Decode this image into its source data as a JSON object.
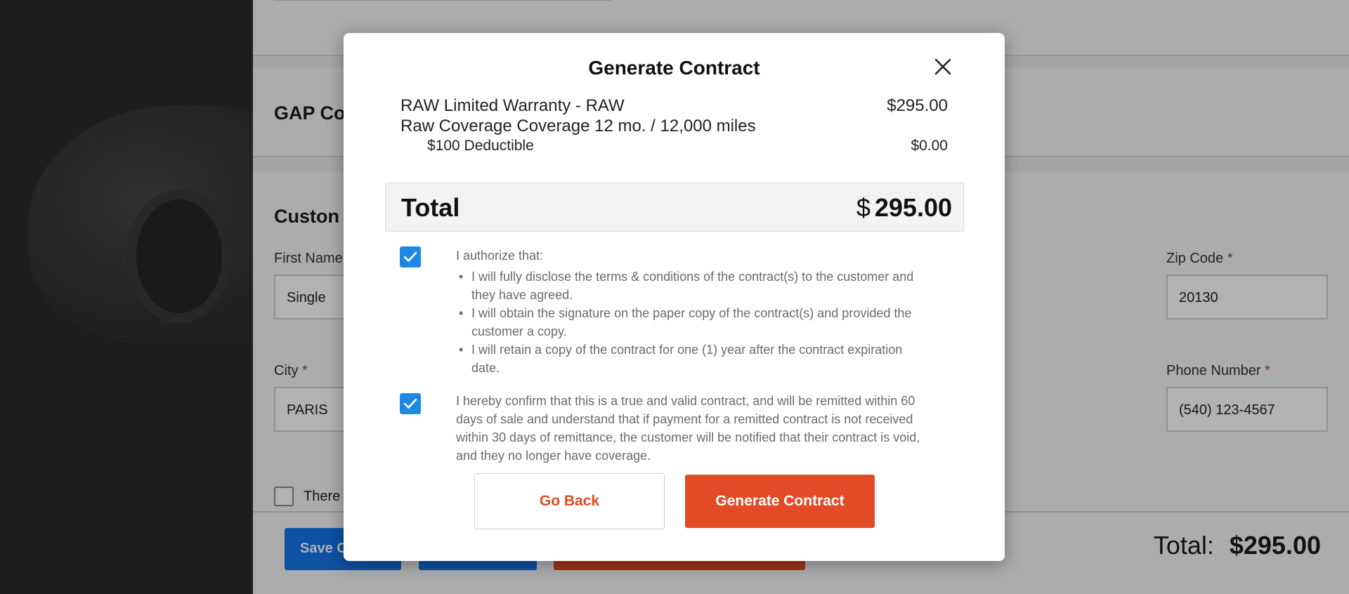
{
  "background": {
    "sections": {
      "gap_title": "GAP Co",
      "customer_title": "Custon"
    },
    "fields": {
      "first_name_label": "First Name",
      "first_name_value": "Single",
      "zip_label": "Zip Code",
      "zip_value": "20130",
      "city_label": "City",
      "city_value": "PARIS",
      "phone_label": "Phone Number",
      "phone_value": "(540) 123-4567",
      "required_mark": "*"
    },
    "checkbox_label": "There",
    "footer": {
      "save_button": "Save C",
      "total_label": "Total:",
      "total_value": "$295.00"
    }
  },
  "modal": {
    "title": "Generate Contract",
    "item": {
      "name": "RAW Limited Warranty - RAW",
      "price": "$295.00",
      "coverage": "Raw Coverage Coverage 12 mo. / 12,000 miles",
      "deductible": "$100 Deductible",
      "deductible_price": "$0.00"
    },
    "total": {
      "label": "Total",
      "currency": "$",
      "amount": "295.00"
    },
    "authorization": {
      "checked": true,
      "intro": "I authorize that:",
      "points": [
        "I will fully disclose the terms & conditions of the contract(s) to the customer and they have agreed.",
        "I will obtain the signature on the paper copy of the contract(s) and provided the customer a copy.",
        "I will retain a copy of the contract for one (1) year after the contract expiration date."
      ]
    },
    "confirmation": {
      "checked": true,
      "text": "I hereby confirm that this is a true and valid contract, and will be remitted within 60 days of sale and understand that if payment for a remitted contract is not received within 30 days of remittance, the customer will be notified that their contract is void, and they no longer have coverage."
    },
    "buttons": {
      "go_back": "Go Back",
      "generate": "Generate Contract"
    }
  },
  "colors": {
    "accent_orange": "#e24b26",
    "checkbox_blue": "#1e88e5",
    "button_blue": "#1474e8"
  }
}
